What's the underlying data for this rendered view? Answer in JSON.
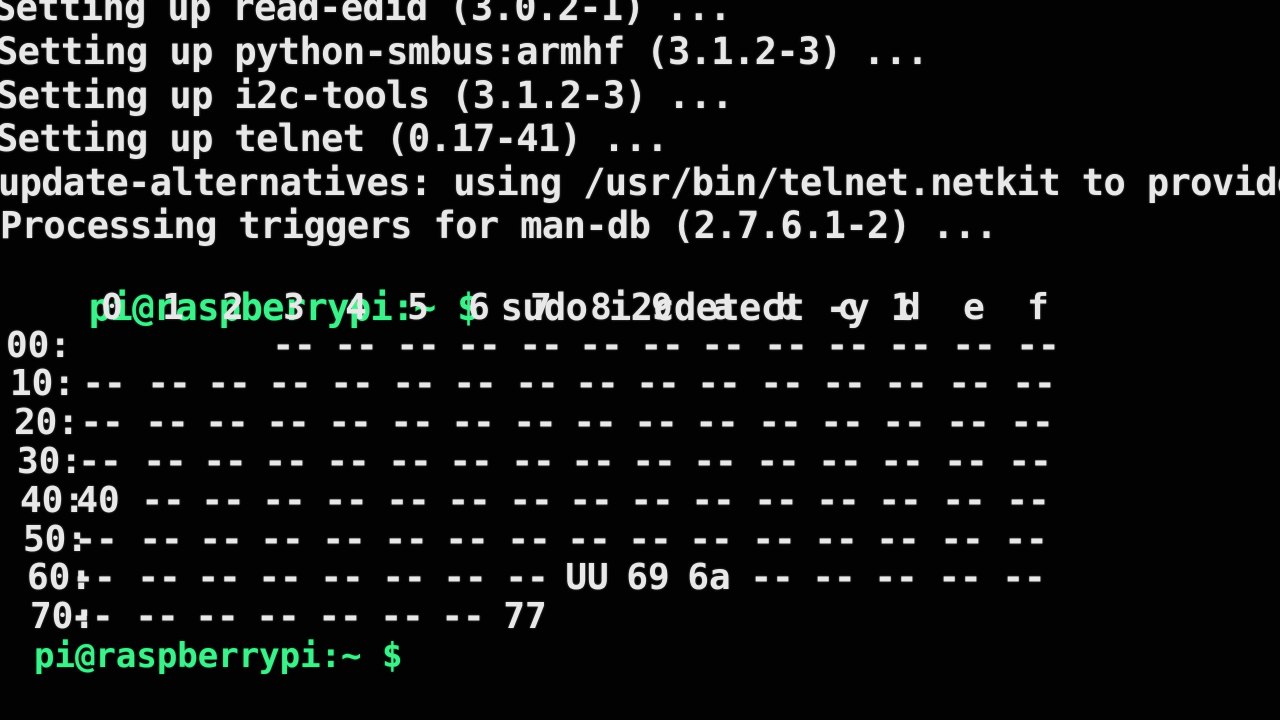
{
  "terminal": {
    "output_lines": [
      "Setting up read-edid (3.0.2-1) ...",
      "Setting up python-smbus:armhf (3.1.2-3) ...",
      "Setting up i2c-tools (3.1.2-3) ...",
      "Setting up telnet (0.17-41) ...",
      "update-alternatives: using /usr/bin/telnet.netkit to provide /",
      "Processing triggers for man-db (2.7.6.1-2) ..."
    ],
    "command_prompt": "pi@raspberrypi:~ $",
    "command": " sudo i2cdetect -y 1",
    "final_prompt": "pi@raspberrypi:~ $",
    "colors": {
      "background": "#020202",
      "text": "#e8e8e8",
      "prompt": "#3cf08a"
    }
  },
  "i2c_table": {
    "column_headers": [
      "0",
      "1",
      "2",
      "3",
      "4",
      "5",
      "6",
      "7",
      "8",
      "9",
      "a",
      "b",
      "c",
      "d",
      "e",
      "f"
    ],
    "rows": [
      {
        "label": "00:",
        "cells": [
          "",
          "",
          "",
          "--",
          "--",
          "--",
          "--",
          "--",
          "--",
          "--",
          "--",
          "--",
          "--",
          "--",
          "--",
          "--"
        ]
      },
      {
        "label": "10:",
        "cells": [
          "--",
          "--",
          "--",
          "--",
          "--",
          "--",
          "--",
          "--",
          "--",
          "--",
          "--",
          "--",
          "--",
          "--",
          "--",
          "--"
        ]
      },
      {
        "label": "20:",
        "cells": [
          "--",
          "--",
          "--",
          "--",
          "--",
          "--",
          "--",
          "--",
          "--",
          "--",
          "--",
          "--",
          "--",
          "--",
          "--",
          "--"
        ]
      },
      {
        "label": "30:",
        "cells": [
          "--",
          "--",
          "--",
          "--",
          "--",
          "--",
          "--",
          "--",
          "--",
          "--",
          "--",
          "--",
          "--",
          "--",
          "--",
          "--"
        ]
      },
      {
        "label": "40:",
        "cells": [
          "40",
          "--",
          "--",
          "--",
          "--",
          "--",
          "--",
          "--",
          "--",
          "--",
          "--",
          "--",
          "--",
          "--",
          "--",
          "--"
        ]
      },
      {
        "label": "50:",
        "cells": [
          "--",
          "--",
          "--",
          "--",
          "--",
          "--",
          "--",
          "--",
          "--",
          "--",
          "--",
          "--",
          "--",
          "--",
          "--",
          "--"
        ]
      },
      {
        "label": "60:",
        "cells": [
          "--",
          "--",
          "--",
          "--",
          "--",
          "--",
          "--",
          "--",
          "UU",
          "69",
          "6a",
          "--",
          "--",
          "--",
          "--",
          "--"
        ]
      },
      {
        "label": "70:",
        "cells": [
          "--",
          "--",
          "--",
          "--",
          "--",
          "--",
          "--",
          "77",
          "",
          "",
          "",
          "",
          "",
          "",
          "",
          ""
        ]
      }
    ]
  }
}
